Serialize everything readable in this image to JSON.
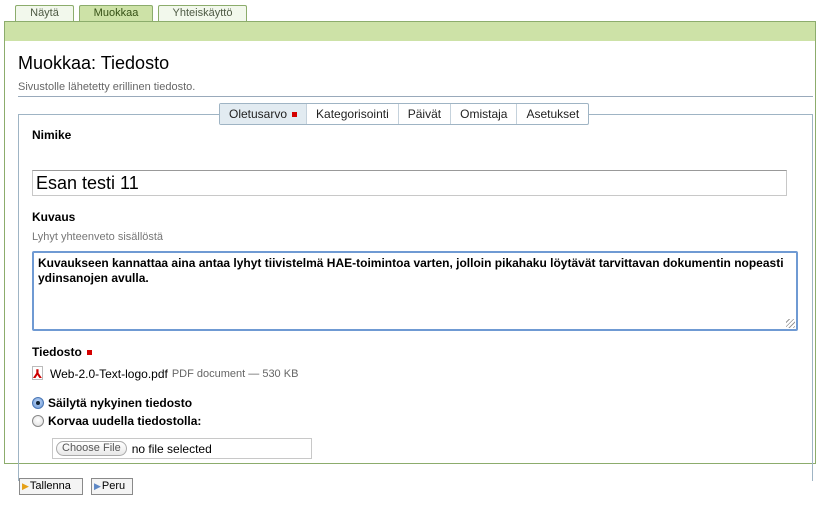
{
  "top_tabs": [
    {
      "label": "Näytä",
      "active": false
    },
    {
      "label": "Muokkaa",
      "active": true
    },
    {
      "label": "Yhteiskäyttö",
      "active": false
    }
  ],
  "page": {
    "title": "Muokkaa: Tiedosto",
    "description": "Sivustolle lähetetty erillinen tiedosto."
  },
  "inner_tabs": [
    {
      "label": "Oletusarvo",
      "active": true,
      "required": true
    },
    {
      "label": "Kategorisointi",
      "active": false,
      "required": false
    },
    {
      "label": "Päivät",
      "active": false,
      "required": false
    },
    {
      "label": "Omistaja",
      "active": false,
      "required": false
    },
    {
      "label": "Asetukset",
      "active": false,
      "required": false
    }
  ],
  "form": {
    "title_label": "Nimike",
    "title_value": "Esan testi 11",
    "desc_label": "Kuvaus",
    "desc_help": "Lyhyt yhteenveto sisällöstä",
    "desc_value": "Kuvaukseen kannattaa aina antaa lyhyt tiivistelmä HAE-toimintoa varten, jolloin pikahaku löytävät tarvittavan dokumentin nopeasti ydinsanojen avulla.",
    "file_label": "Tiedosto",
    "file_name": "Web-2.0-Text-logo.pdf",
    "file_meta": "PDF document — 530 KB",
    "keep_label": "Säilytä nykyinen tiedosto",
    "replace_label": "Korvaa uudella tiedostolla:",
    "choose_label": "Choose File",
    "no_file_text": "no file selected"
  },
  "buttons": {
    "save_label": "Tallenna",
    "cancel_label": "Peru"
  },
  "colors": {
    "accent_green": "#cde2a7",
    "border_green": "#8cac6c",
    "required_red": "#d40000",
    "focus_blue": "#6f9ad3"
  }
}
